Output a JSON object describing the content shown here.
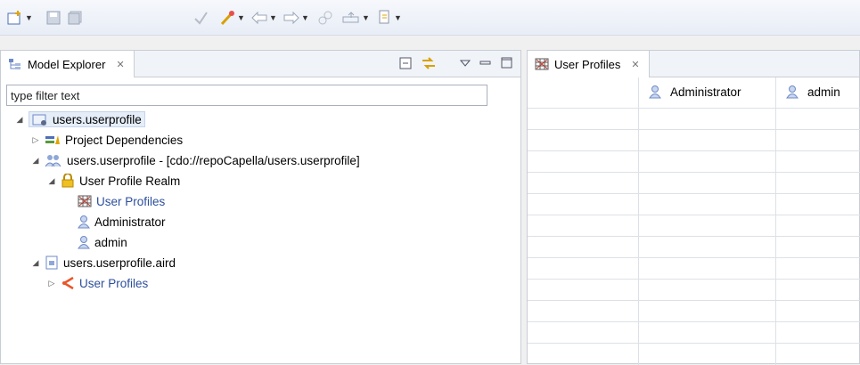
{
  "toolbar": {
    "icons": [
      "new-icon",
      "save-icon",
      "save-all-icon",
      "validate-icon",
      "wand-icon",
      "back-icon",
      "forward-icon",
      "link-icon",
      "export-icon",
      "run-icon"
    ]
  },
  "explorer": {
    "tab_label": "Model Explorer",
    "filter_value": "type filter text",
    "tree": [
      {
        "label": "users.userprofile"
      },
      {
        "label": "Project Dependencies"
      },
      {
        "label": "users.userprofile - [cdo://repoCapella/users.userprofile]"
      },
      {
        "label": "User Profile Realm"
      },
      {
        "label": "User Profiles"
      },
      {
        "label": "Administrator"
      },
      {
        "label": "admin"
      },
      {
        "label": "users.userprofile.aird"
      },
      {
        "label": "User Profiles"
      }
    ]
  },
  "editor": {
    "tab_label": "User Profiles",
    "columns": [
      "Administrator",
      "admin"
    ]
  },
  "colors": {
    "link": "#2c4f9b",
    "selection": "#e5edf8"
  }
}
